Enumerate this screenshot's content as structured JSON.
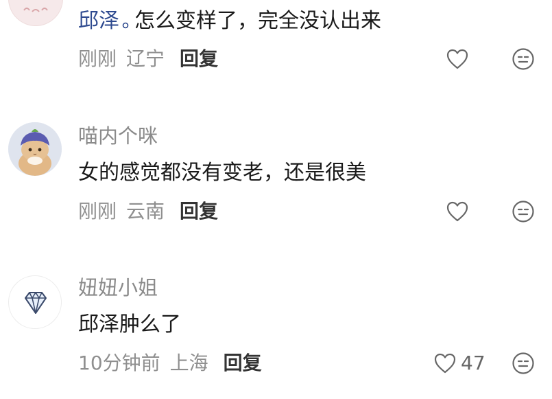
{
  "comments": [
    {
      "username": "",
      "mention": "邱泽",
      "text": "怎么变样了，完全没认出来",
      "time": "刚刚",
      "location": "辽宁",
      "reply_label": "回复",
      "like_count": ""
    },
    {
      "username": "喵内个咪",
      "text": "女的感觉都没有变老，还是很美",
      "time": "刚刚",
      "location": "云南",
      "reply_label": "回复",
      "like_count": ""
    },
    {
      "username": "妞妞小姐",
      "text": "邱泽肿么了",
      "time": "10分钟前",
      "location": "上海",
      "reply_label": "回复",
      "like_count": "47"
    }
  ],
  "icons": {
    "like": "heart-outline-icon",
    "emoji": "smiley-face-icon",
    "mention": "search-mention-icon"
  },
  "colors": {
    "mention": "#2e4a8f",
    "meta": "#8f8f8f",
    "reply": "#333333",
    "icon": "#666666"
  }
}
